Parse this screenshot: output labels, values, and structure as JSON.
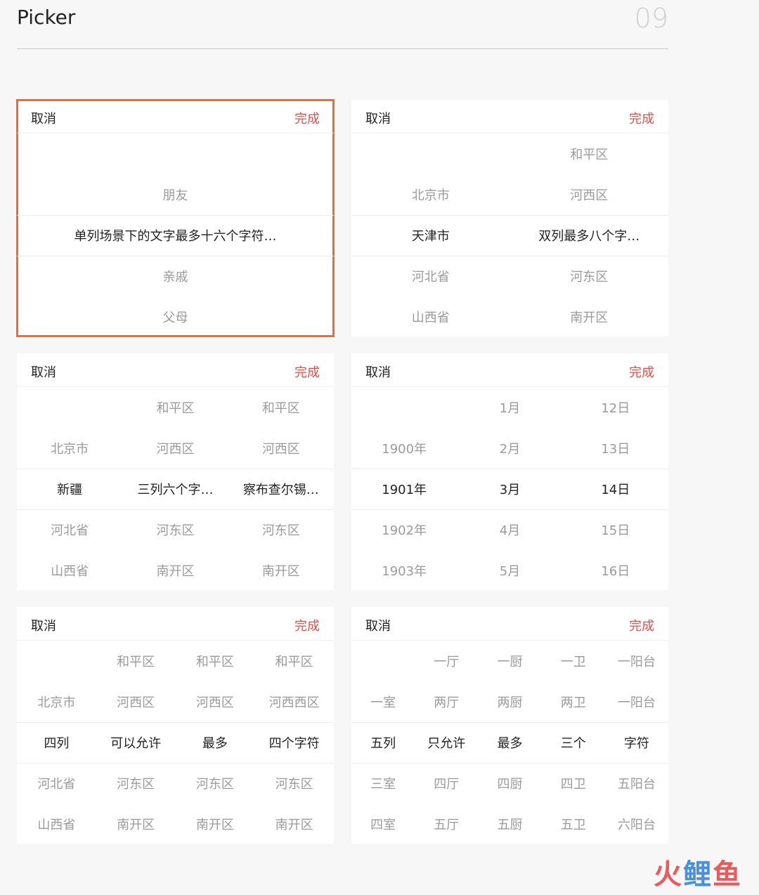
{
  "header": {
    "title": "Picker",
    "page_number": "09"
  },
  "common": {
    "cancel": "取消",
    "done": "完成"
  },
  "pickers": [
    {
      "name": "single",
      "columns": [
        [
          "",
          "朋友",
          "单列场景下的文字最多十六个字符…",
          "亲戚",
          "父母"
        ]
      ]
    },
    {
      "name": "double",
      "columns": [
        [
          "",
          "北京市",
          "天津市",
          "河北省",
          "山西省"
        ],
        [
          "和平区",
          "河西区",
          "双列最多八个字…",
          "河东区",
          "南开区"
        ]
      ]
    },
    {
      "name": "triple",
      "columns": [
        [
          "",
          "北京市",
          "新疆",
          "河北省",
          "山西省"
        ],
        [
          "和平区",
          "河西区",
          "三列六个字…",
          "河东区",
          "南开区"
        ],
        [
          "和平区",
          "河西区",
          "察布查尔锡…",
          "河东区",
          "南开区"
        ]
      ]
    },
    {
      "name": "date",
      "columns": [
        [
          "",
          "1900年",
          "1901年",
          "1902年",
          "1903年"
        ],
        [
          "1月",
          "2月",
          "3月",
          "4月",
          "5月"
        ],
        [
          "12日",
          "13日",
          "14日",
          "15日",
          "16日"
        ]
      ]
    },
    {
      "name": "quad",
      "columns": [
        [
          "",
          "北京市",
          "四列",
          "河北省",
          "山西省"
        ],
        [
          "和平区",
          "河西区",
          "可以允许",
          "河东区",
          "南开区"
        ],
        [
          "和平区",
          "河西区",
          "最多",
          "河东区",
          "南开区"
        ],
        [
          "和平区",
          "河西西区",
          "四个字符",
          "河东区",
          "南开区"
        ]
      ]
    },
    {
      "name": "penta",
      "columns": [
        [
          "",
          "一室",
          "五列",
          "三室",
          "四室"
        ],
        [
          "一厅",
          "两厅",
          "只允许",
          "四厅",
          "五厅"
        ],
        [
          "一厨",
          "两厨",
          "最多",
          "四厨",
          "五厨"
        ],
        [
          "一卫",
          "两卫",
          "三个",
          "四卫",
          "五卫"
        ],
        [
          "一阳台",
          "一阳台",
          "字符",
          "五阳台",
          "六阳台"
        ]
      ]
    }
  ],
  "watermark": {
    "part1": "火",
    "part2": "鲤",
    "part3": "鱼"
  },
  "colors": {
    "accent": "#f04b47",
    "highlight": "#ec6c33",
    "text": "#222222",
    "muted": "#9a9a9a"
  }
}
